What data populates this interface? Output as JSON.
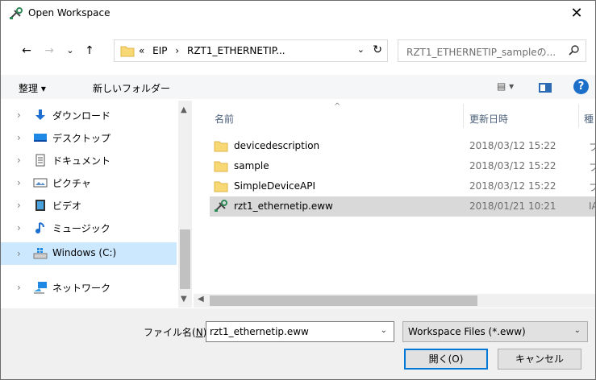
{
  "window": {
    "title": "Open Workspace",
    "close_glyph": "✕",
    "app_icon": "iar-tools-icon"
  },
  "address": {
    "back_glyph": "←",
    "forward_glyph": "→",
    "recent_glyph": "⌄",
    "up_glyph": "↑",
    "overflow": "«",
    "crumbs": [
      "EIP",
      "›",
      "RZT1_ETHERNETIP..."
    ],
    "first_sep": "›",
    "dropdown_glyph": "⌄",
    "refresh_glyph": "↻"
  },
  "search": {
    "placeholder": "RZT1_ETHERNETIP_sampleの...",
    "icon": "search-icon"
  },
  "toolbar": {
    "organize_label": "整理 ▾",
    "new_folder_label": "新しいフォルダー",
    "view_label": "▤ ▾",
    "help_label": "?"
  },
  "nav": {
    "items": [
      {
        "label": "ダウンロード",
        "icon": "download-icon",
        "chev": "›"
      },
      {
        "label": "デスクトップ",
        "icon": "desktop-icon",
        "chev": "›"
      },
      {
        "label": "ドキュメント",
        "icon": "documents-icon",
        "chev": "›"
      },
      {
        "label": "ピクチャ",
        "icon": "pictures-icon",
        "chev": "›"
      },
      {
        "label": "ビデオ",
        "icon": "videos-icon",
        "chev": "›"
      },
      {
        "label": "ミュージック",
        "icon": "music-icon",
        "chev": "›"
      },
      {
        "label": "Windows (C:)",
        "icon": "drive-icon",
        "chev": "›"
      },
      {
        "label": "ネットワーク",
        "icon": "network-icon",
        "chev": "›"
      }
    ]
  },
  "columns": {
    "name": "名前",
    "date": "更新日時",
    "type": "種",
    "sort_glyph": "^"
  },
  "files": [
    {
      "name": "devicedescription",
      "date": "2018/03/12 15:22",
      "type": "フ",
      "icon": "folder-icon"
    },
    {
      "name": "sample",
      "date": "2018/03/12 15:22",
      "type": "フ",
      "icon": "folder-icon"
    },
    {
      "name": "SimpleDeviceAPI",
      "date": "2018/03/12 15:22",
      "type": "フ",
      "icon": "folder-icon"
    },
    {
      "name": "rzt1_ethernetip.eww",
      "date": "2018/01/21 10:21",
      "type": "IA",
      "icon": "workspace-file-icon"
    }
  ],
  "scroll": {
    "up": "▲",
    "down": "▼",
    "left": "◀"
  },
  "bottom": {
    "filename_label_pre": "ファイル名(",
    "filename_label_key": "N",
    "filename_label_post": "):",
    "filename_value": "rzt1_ethernetip.eww",
    "filter_value": "Workspace Files (*.eww)",
    "dropdown_glyph": "⌄",
    "open_label": "開く(O)",
    "cancel_label": "キャンセル"
  }
}
